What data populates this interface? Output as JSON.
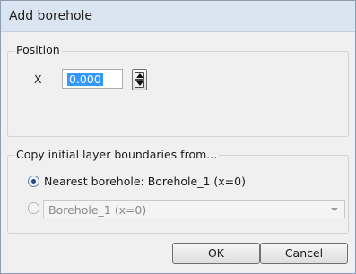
{
  "window": {
    "title": "Add borehole"
  },
  "position_group": {
    "legend": "Position",
    "x_label": "X",
    "x_value": "0.000"
  },
  "copy_group": {
    "legend": "Copy initial layer boundaries from...",
    "nearest_label": "Nearest borehole: Borehole_1 (x=0)",
    "nearest_selected": true,
    "other_selected": false,
    "combo_value": "Borehole_1 (x=0)"
  },
  "buttons": {
    "ok_label": "OK",
    "cancel_label": "Cancel"
  },
  "icons": {
    "spinner": "spinner-up-down-icon",
    "combo_arrow": "chevron-down-icon"
  },
  "colors": {
    "selection": "#3399ff",
    "titlebar": "#dbe4f1",
    "dialog_bg": "#f0f0f0"
  }
}
